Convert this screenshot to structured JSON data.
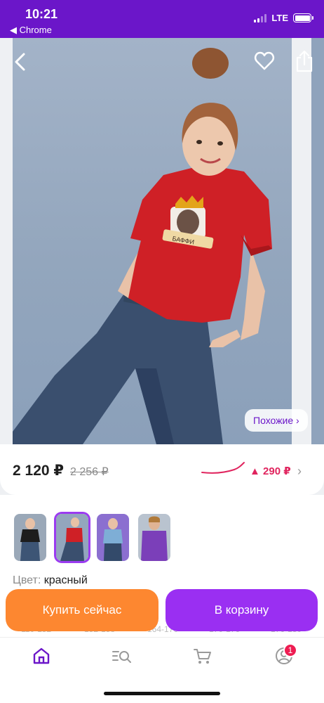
{
  "status_bar": {
    "time": "10:21",
    "back_app": "◀ Chrome",
    "network": "LTE"
  },
  "product": {
    "price": "2 120 ₽",
    "old_price": "2 256 ₽",
    "price_drop": "▲ 290 ₽",
    "similar_button": "Похожие ›",
    "print_text": "БАФФИ"
  },
  "variants": {
    "thumbnails": [
      {
        "name": "black",
        "color": "#1d1d1d"
      },
      {
        "name": "red",
        "color": "#cf2026"
      },
      {
        "name": "blue",
        "color": "#7eaed6"
      },
      {
        "name": "purple",
        "color": "#7b3fb9"
      }
    ],
    "selected_index": 1,
    "color_label": "Цвет:",
    "color_value": "красный"
  },
  "sizes_partial": [
    "110-152",
    "152-158",
    "164-170",
    "170-176",
    "176-180"
  ],
  "actions": {
    "buy_now": "Купить сейчас",
    "add_to_cart": "В корзину"
  },
  "bottom_nav": {
    "items": [
      "home-icon",
      "catalog-search-icon",
      "cart-icon",
      "profile-icon"
    ],
    "active": "home-icon",
    "profile_badge": "1"
  },
  "colors": {
    "brand": "#6b16c9",
    "buy_button": "#fd8730",
    "cart_button": "#9a2ff2",
    "price_drop": "#e0245e"
  }
}
